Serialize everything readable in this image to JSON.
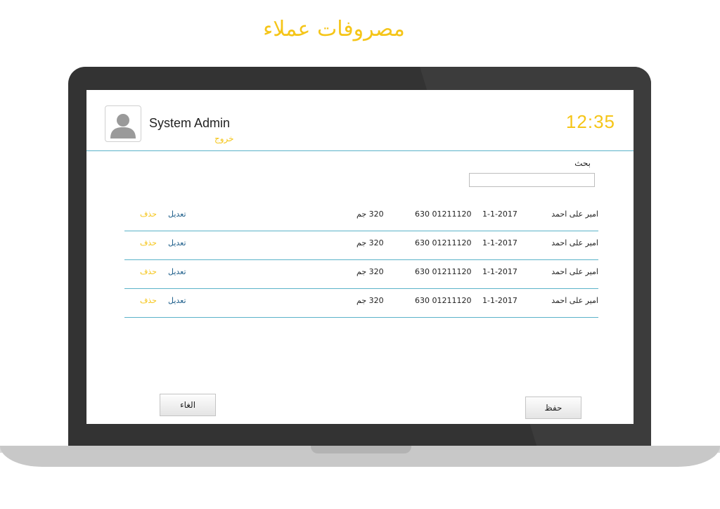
{
  "page": {
    "title": "مصروفات عملاء"
  },
  "header": {
    "user_name": "System Admin",
    "logout_label": "خروج",
    "clock": "12:35"
  },
  "search": {
    "label": "بحث",
    "value": "",
    "placeholder": ""
  },
  "table": {
    "rows": [
      {
        "name": "امير على احمد",
        "date": "1-1-2017",
        "phone": "630 01211120",
        "amount": "320 جم",
        "edit": "تعديل",
        "delete": "حذف"
      },
      {
        "name": "امير على احمد",
        "date": "1-1-2017",
        "phone": "630 01211120",
        "amount": "320 جم",
        "edit": "تعديل",
        "delete": "حذف"
      },
      {
        "name": "امير على احمد",
        "date": "1-1-2017",
        "phone": "630 01211120",
        "amount": "320 جم",
        "edit": "تعديل",
        "delete": "حذف"
      },
      {
        "name": "امير على احمد",
        "date": "1-1-2017",
        "phone": "630 01211120",
        "amount": "320 جم",
        "edit": "تعديل",
        "delete": "حذف"
      }
    ]
  },
  "buttons": {
    "cancel_label": "الغاء",
    "save_label": "حفظ"
  },
  "colors": {
    "accent": "#f5c518",
    "rule": "#5bb3c9",
    "link": "#1f5f8b",
    "laptop": "#333333"
  },
  "icons": {
    "avatar": "user-avatar-icon"
  }
}
